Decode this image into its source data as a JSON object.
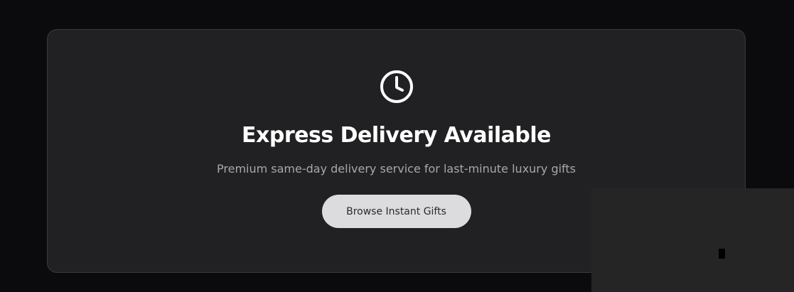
{
  "banner": {
    "icon": "clock-icon",
    "title": "Express Delivery Available",
    "subtitle": "Premium same-day delivery service for last-minute luxury gifts",
    "cta_label": "Browse Instant Gifts"
  },
  "colors": {
    "page_background": "#0b0b0d",
    "card_background": "#212123",
    "card_border": "#3a3a3e",
    "title": "#ffffff",
    "subtitle": "#a8a8ad",
    "button_background": "#dcdcdf",
    "button_text": "#2a2a2e"
  }
}
